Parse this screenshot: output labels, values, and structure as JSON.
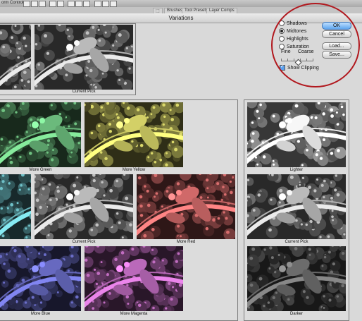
{
  "topbar": {
    "menu_label": "orm Controls",
    "tab_brushes": "Brushes",
    "tab_tool_presets": "Tool Presets",
    "tab_layer_comps": "Layer Comps"
  },
  "dialog": {
    "title": "Variations"
  },
  "controls": {
    "radios": [
      {
        "label": "Shadows",
        "selected": false
      },
      {
        "label": "Midtones",
        "selected": true
      },
      {
        "label": "Highlights",
        "selected": false
      },
      {
        "label": "Saturation",
        "selected": false
      }
    ],
    "fine_label": "Fine",
    "coarse_label": "Coarse",
    "slider_value": 0.5,
    "show_clipping_label": "Show Clipping",
    "show_clipping_checked": true
  },
  "buttons": {
    "ok": "OK",
    "cancel": "Cancel",
    "load": "Load...",
    "save": "Save..."
  },
  "thumbnails": {
    "original": "",
    "current_pick_top": "Current Pick",
    "more_green": "More Green",
    "more_yellow": "More Yellow",
    "more_cyan": "",
    "current_pick_center": "Current Pick",
    "more_red": "More Red",
    "more_blue": "More Blue",
    "more_magenta": "More Magenta",
    "lighter": "Lighter",
    "current_pick_right": "Current Pick",
    "darker": "Darker"
  },
  "colors": {
    "green": "#4f8a5c",
    "yellow": "#9c9a4c",
    "cyan": "#4f8a8f",
    "red": "#9a4e4e",
    "blue": "#4c4e8e",
    "magenta": "#8a4e8a",
    "neutral": "#8a8a8a",
    "light": "#b7b7b7",
    "dark": "#505050",
    "highlight_ring": "#b1181e",
    "ok_button": "#5fa5ee"
  }
}
